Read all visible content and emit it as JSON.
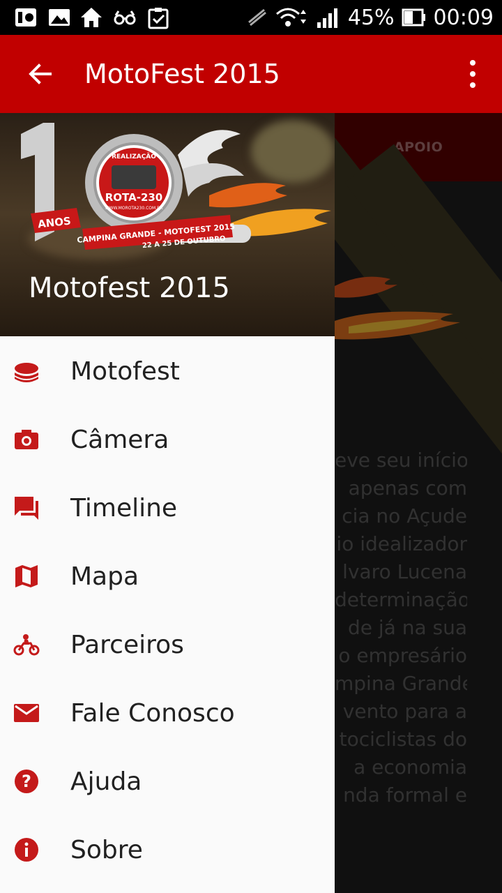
{
  "status_bar": {
    "battery": "45%",
    "time": "00:09",
    "icons": [
      "media-icon",
      "image-icon",
      "home-icon",
      "glasses-icon",
      "clipboard-check-icon",
      "mute-icon",
      "wifi-icon",
      "signal-icon",
      "battery-icon"
    ]
  },
  "app_bar": {
    "title": "MotoFest 2015",
    "back_icon": "arrow-back-icon",
    "menu_icon": "more-vert-icon",
    "color": "#c10000"
  },
  "background": {
    "tabs": [
      "APOIO"
    ],
    "text_lines": [
      "eve seu início",
      "apenas com",
      "cia no Açude",
      "io idealizador",
      "lvaro Lucena",
      "determinação,",
      "de já na sua",
      "o empresário",
      "mpina Grande",
      "vento para a",
      "tociclistas do",
      "a economia",
      "nda formal e"
    ]
  },
  "drawer": {
    "header_title": "Motofest 2015",
    "logo": {
      "big_number": "10",
      "badge_top": "REALIZAÇÃO",
      "badge_name": "ROTA-230",
      "badge_url": "WWW.MOROTA230.COM.BR",
      "anos": "ANOS",
      "banner": "CAMPINA GRANDE - MOTOFEST 2015",
      "dates": "22 A 25 DE OUTUBRO"
    },
    "items": [
      {
        "label": "Motofest",
        "icon": "layers-icon"
      },
      {
        "label": "Câmera",
        "icon": "camera-icon"
      },
      {
        "label": "Timeline",
        "icon": "chat-icon"
      },
      {
        "label": "Mapa",
        "icon": "map-icon"
      },
      {
        "label": "Parceiros",
        "icon": "motorcycle-icon"
      },
      {
        "label": "Fale Conosco",
        "icon": "email-icon"
      },
      {
        "label": "Ajuda",
        "icon": "help-icon"
      },
      {
        "label": "Sobre",
        "icon": "info-icon"
      }
    ],
    "icon_color": "#c41a1a"
  }
}
